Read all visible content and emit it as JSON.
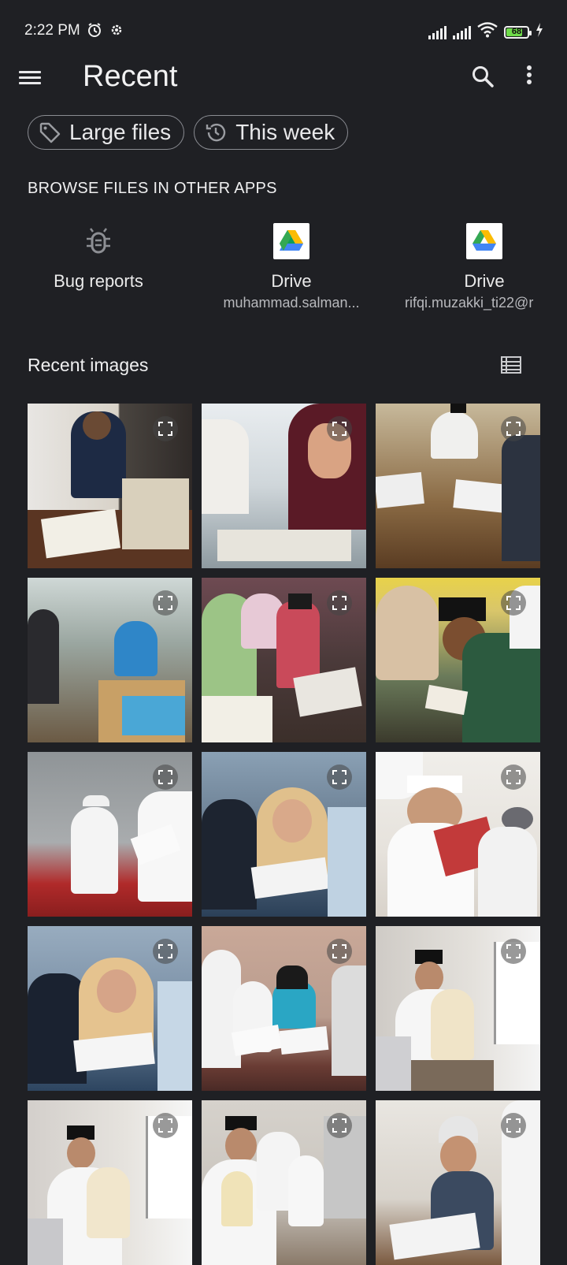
{
  "status_bar": {
    "time": "2:22 PM",
    "battery": "68",
    "icons": [
      "alarm-icon",
      "settings-icon",
      "signal-icon",
      "signal-icon",
      "wifi-icon",
      "battery-icon",
      "charging-icon"
    ]
  },
  "app_bar": {
    "title": "Recent"
  },
  "chips": [
    {
      "label": "Large files",
      "icon": "tag-icon"
    },
    {
      "label": "This week",
      "icon": "history-icon"
    }
  ],
  "browse": {
    "heading": "BROWSE FILES IN OTHER APPS",
    "apps": [
      {
        "label": "Bug reports",
        "sub": "",
        "icon": "bug-icon"
      },
      {
        "label": "Drive",
        "sub": "muhammad.salman...",
        "icon": "drive-icon"
      },
      {
        "label": "Drive",
        "sub": "rifqi.muzakki_ti22@r",
        "icon": "drive-icon"
      }
    ]
  },
  "recent_images": {
    "heading": "Recent images",
    "count": 15
  },
  "colors": {
    "background": "#1f2024",
    "text": "#e8e8ea",
    "chip_border": "#8a8c92",
    "battery_fill": "#6fdc4a"
  }
}
